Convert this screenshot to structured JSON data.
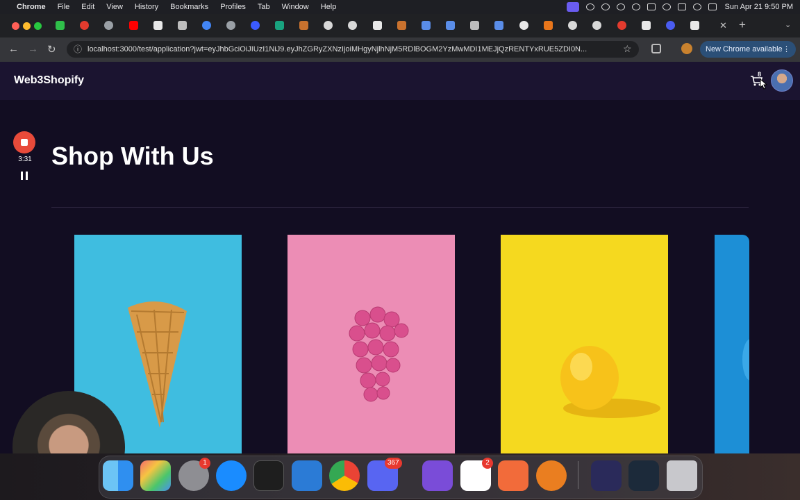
{
  "menubar": {
    "app_name": "Chrome",
    "menus": [
      "File",
      "Edit",
      "View",
      "History",
      "Bookmarks",
      "Profiles",
      "Tab",
      "Window",
      "Help"
    ],
    "clock": "Sun Apr 21  9:50 PM"
  },
  "browser": {
    "url": "localhost:3000/test/application?jwt=eyJhbGciOiJIUzI1NiJ9.eyJhZGRyZXNzIjoiMHgyNjlhNjM5RDlBOGM2YzMwMDI1MEJjQzRENTYxRUE5ZDI0N...",
    "update_label": "New Chrome available"
  },
  "site": {
    "brand": "Web3Shopify",
    "title": "Shop With Us",
    "cart_count": "8"
  },
  "recorder": {
    "elapsed": "3:31"
  },
  "products": [
    {
      "name": "ice-cream-cone",
      "bg": "#3fbde0"
    },
    {
      "name": "grapes",
      "bg": "#ec8db5"
    },
    {
      "name": "lemon",
      "bg": "#f5d91f"
    },
    {
      "name": "partial-blue",
      "bg": "#1d8fd6"
    }
  ],
  "dock": {
    "badges": {
      "system_settings": "1",
      "discord": "367",
      "slack": "2"
    }
  }
}
